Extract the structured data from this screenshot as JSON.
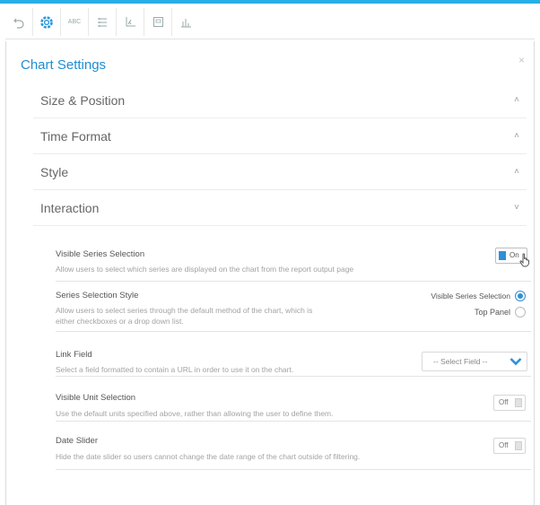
{
  "toolbar": {
    "buttons": [
      {
        "name": "undo-icon"
      },
      {
        "name": "gear-icon"
      },
      {
        "name": "abc-text-icon",
        "label": "ABC"
      },
      {
        "name": "list-icon"
      },
      {
        "name": "axes-icon"
      },
      {
        "name": "image-icon"
      },
      {
        "name": "bar-chart-icon"
      }
    ]
  },
  "panel": {
    "title": "Chart Settings",
    "close": "×"
  },
  "accordion": {
    "size_position": "Size & Position",
    "time_format": "Time Format",
    "style": "Style",
    "interaction": "Interaction",
    "chev_up": "˄",
    "chev_down": "˅"
  },
  "settings": {
    "visible_series": {
      "title": "Visible Series Selection",
      "desc": "Allow users to select which series are displayed on the chart from the report output page",
      "toggle": "On"
    },
    "series_style": {
      "title": "Series Selection Style",
      "desc1": "Allow users to select series through the default method of the chart, which is",
      "desc2": "either checkboxes or a drop down list.",
      "option1": "Visible Series Selection",
      "option2": "Top Panel"
    },
    "link_field": {
      "title": "Link Field",
      "desc": "Select a field formatted to contain a URL in order to use it on the chart.",
      "select": "-- Select Field --"
    },
    "visible_unit": {
      "title": "Visible Unit Selection",
      "desc": "Use the default units specified above, rather than allowing the user to define them.",
      "toggle": "Off"
    },
    "date_slider": {
      "title": "Date Slider",
      "desc": "Hide the date slider so users cannot change the date range of the chart outside of filtering.",
      "toggle": "Off"
    }
  },
  "colors": {
    "accent": "#1f8ed1",
    "toggle_on": "#2f8fd8",
    "top_bar": "#28aee6"
  }
}
